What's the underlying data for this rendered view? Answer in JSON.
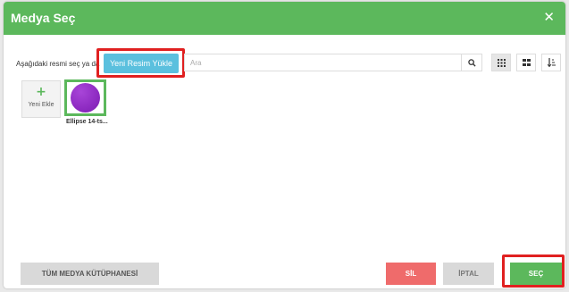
{
  "modal": {
    "title": "Medya Seç",
    "close_icon": "close-icon"
  },
  "toolbar": {
    "label": "Aşağıdaki resmi seç ya da",
    "upload_button": "Yeni Resim Yükle",
    "search_placeholder": "Ara",
    "icons": [
      "search-icon",
      "grid-small-icon",
      "grid-large-icon",
      "sort-icon"
    ]
  },
  "media": {
    "add_new_label": "Yeni Ekle",
    "items": [
      {
        "caption": "Ellipse 14-ts..."
      }
    ]
  },
  "footer": {
    "library_button": "TÜM MEDYA KÜTÜPHANESİ",
    "delete_button": "SİL",
    "cancel_button": "İPTAL",
    "select_button": "SEÇ"
  },
  "colors": {
    "header": "#5cb85c",
    "upload": "#5bc0de",
    "delete": "#ef6b6b",
    "select": "#5cb85c",
    "highlight": "#e02020",
    "ellipse": "#8e2bc2"
  }
}
